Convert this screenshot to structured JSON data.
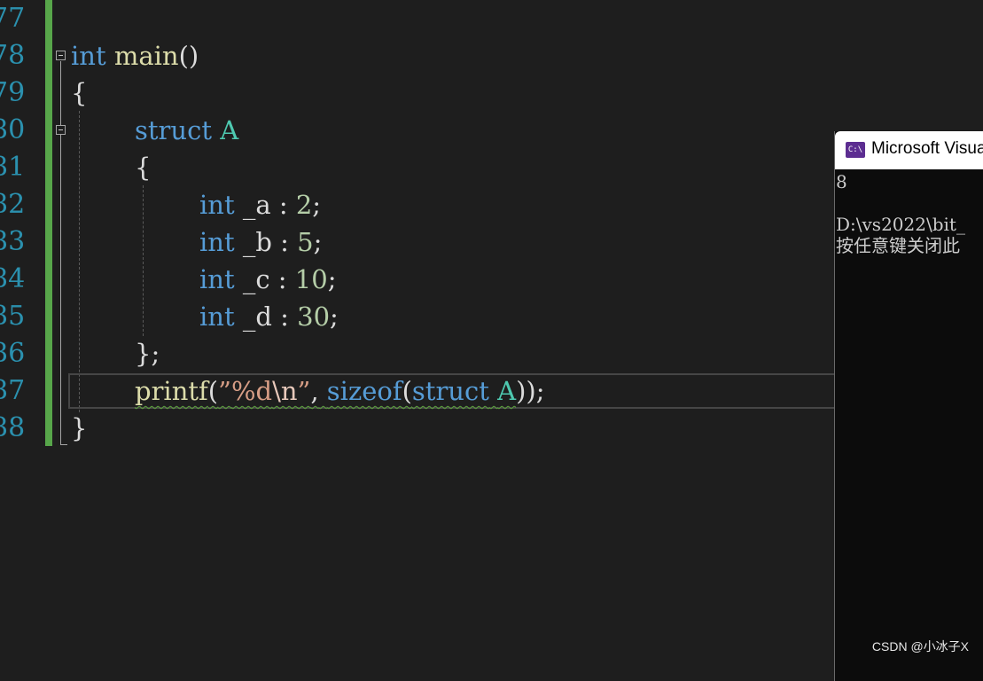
{
  "editor": {
    "line_numbers": [
      "77",
      "78",
      "79",
      "80",
      "81",
      "82",
      "83",
      "84",
      "85",
      "86",
      "87",
      "88"
    ],
    "code": {
      "l78": {
        "kw": "int",
        "name": "main",
        "parens": "()"
      },
      "l79": {
        "brace": "{"
      },
      "l80": {
        "kw": "struct",
        "type": "A"
      },
      "l81": {
        "brace": "{"
      },
      "l82": {
        "kw": "int",
        "field": "_a",
        "sep": ":",
        "num": "2",
        "semi": ";"
      },
      "l83": {
        "kw": "int",
        "field": "_b",
        "sep": ":",
        "num": "5",
        "semi": ";"
      },
      "l84": {
        "kw": "int",
        "field": "_c",
        "sep": ":",
        "num": "10",
        "semi": ";"
      },
      "l85": {
        "kw": "int",
        "field": "_d",
        "sep": ":",
        "num": "30",
        "semi": ";"
      },
      "l86": {
        "close": "}",
        "semi": ";"
      },
      "l87": {
        "fn": "printf",
        "open_paren": "(",
        "str_open": "”",
        "fmt": "%d",
        "esc": "\\n",
        "str_close": "”",
        "comma": ",",
        "sizeof": "sizeof",
        "inner_open": "(",
        "struct_kw": "struct",
        "type": "A",
        "tail": "));"
      },
      "l88": {
        "brace": "}"
      }
    }
  },
  "console": {
    "title": "Microsoft Visua",
    "icon_label": "C:\\",
    "icon": "console-app-icon",
    "output": [
      "8",
      "",
      "D:\\vs2022\\bit_",
      "按任意键关闭此"
    ]
  },
  "watermark": "CSDN @小冰子X",
  "colors": {
    "editor_bg": "#1e1e1e",
    "keyword": "#569cd6",
    "function": "#dcdcaa",
    "type": "#4ec9b0",
    "number": "#b5cea8",
    "string": "#d69d85",
    "line_number": "#2b91af",
    "change_bar": "#57a64a",
    "console_bg": "#0c0c0c"
  }
}
